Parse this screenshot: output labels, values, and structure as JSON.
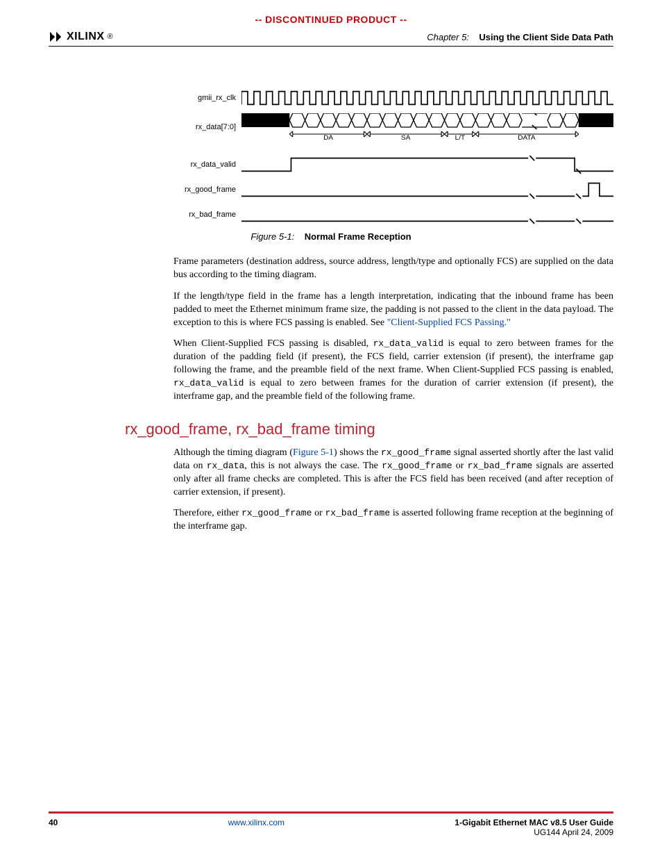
{
  "banner": "-- DISCONTINUED PRODUCT --",
  "logo_text": "XILINX",
  "logo_reg": "®",
  "chapter_num": "Chapter 5:",
  "chapter_title": "Using the Client Side Data Path",
  "timing": {
    "signals": {
      "clk": "gmii_rx_clk",
      "data": "rx_data[7:0]",
      "valid": "rx_data_valid",
      "good": "rx_good_frame",
      "bad": "rx_bad_frame"
    },
    "data_labels": {
      "da": "DA",
      "sa": "SA",
      "lt": "L/T",
      "payload": "DATA"
    }
  },
  "figure": {
    "num": "Figure 5-1:",
    "title": "Normal Frame Reception"
  },
  "para1": "Frame parameters (destination address, source address, length/type and optionally FCS) are supplied on the data bus according to the timing diagram.",
  "para2_a": "If the length/type field in the frame has a length interpretation, indicating that the inbound frame has been padded to meet the Ethernet minimum frame size, the padding is not passed to the client in the data payload. The exception to this is where FCS passing is enabled. See ",
  "para2_link": "\"Client-Supplied FCS Passing.\"",
  "para3_a": "When Client-Supplied FCS passing is disabled, ",
  "para3_code1": "rx_data_valid",
  "para3_b": " is equal to zero between frames for the duration of the padding field (if present), the FCS field, carrier extension (if present), the interframe gap following the frame, and the preamble field of the next frame. When Client-Supplied FCS passing is enabled, ",
  "para3_code2": "rx_data_valid",
  "para3_c": " is equal to zero between frames for the duration of carrier extension (if present), the interframe gap, and the preamble field of the following frame.",
  "section_heading": "rx_good_frame, rx_bad_frame timing",
  "para4_a": "Although the timing diagram (",
  "para4_link": "Figure 5-1",
  "para4_b": ") shows the ",
  "para4_code1": "rx_good_frame",
  "para4_c": " signal asserted shortly after the last valid data on ",
  "para4_code2": "rx_data",
  "para4_d": ", this is not always the case. The ",
  "para4_code3": "rx_good_frame",
  "para4_e": " or ",
  "para4_code4": "rx_bad_frame",
  "para4_f": " signals are asserted only after all frame checks are completed. This is after the FCS field has been received (and after reception of carrier extension, if present).",
  "para5_a": "Therefore, either ",
  "para5_code1": "rx_good_frame",
  "para5_b": " or ",
  "para5_code2": "rx_bad_frame",
  "para5_c": " is asserted following frame reception at the beginning of the interframe gap.",
  "footer": {
    "page": "40",
    "url": "www.xilinx.com",
    "doc_title": "1-Gigabit Ethernet MAC v8.5 User Guide",
    "doc_id": "UG144 April 24, 2009"
  }
}
